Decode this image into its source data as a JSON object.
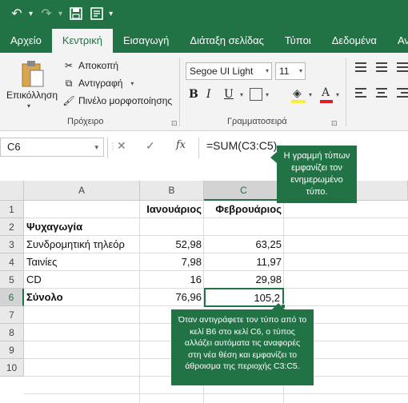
{
  "tabs": [
    "Αρχείο",
    "Κεντρική",
    "Εισαγωγή",
    "Διάταξη σελίδας",
    "Τύποι",
    "Δεδομένα",
    "Αναθ"
  ],
  "active_tab": "Κεντρική",
  "clipboard": {
    "paste_label": "Επικόλληση",
    "cut_label": "Αποκοπή",
    "copy_label": "Αντιγραφή",
    "format_painter_label": "Πινέλο μορφοποίησης",
    "group_label": "Πρόχειρο"
  },
  "font": {
    "name": "Segoe UI Light",
    "size": "11",
    "bold": "B",
    "italic": "I",
    "underline": "U",
    "group_label": "Γραμματοσειρά"
  },
  "formula_bar": {
    "name_box": "C6",
    "cancel": "✕",
    "enter": "✓",
    "fx": "fx",
    "formula": "=SUM(C3:C5)"
  },
  "callouts": {
    "formula_bar_note": "Η γραμμή τύπων εμφανίζει τον ενημερωμένο τύπο.",
    "copy_note": "Όταν αντιγράφετε τον τύπο από το κελί B6 στο κελί C6, ο τύπος αλλάζει αυτόματα τις αναφορές στη νέα θέση και εμφανίζει το άθροισμα της περιοχής C3:C5."
  },
  "grid": {
    "columns": [
      "A",
      "B",
      "C"
    ],
    "rows": [
      "1",
      "2",
      "3",
      "4",
      "5",
      "6",
      "7",
      "8",
      "9",
      "10"
    ],
    "cells": {
      "B1": "Ιανουάριος",
      "C1": "Φεβρουάριος",
      "A2": "Ψυχαγωγία",
      "A3": "Συνδρομητική τηλεόρ",
      "B3": "52,98",
      "C3": "63,25",
      "A4": "Ταινίες",
      "B4": "7,98",
      "C4": "11,97",
      "A5": "CD",
      "B5": "16",
      "C5": "29,98",
      "A6": "Σύνολο",
      "B6": "76,96",
      "C6": "105,2"
    },
    "selected_cell": "C6"
  },
  "colors": {
    "accent": "#217346",
    "ribbon": "#f3f3f3"
  }
}
